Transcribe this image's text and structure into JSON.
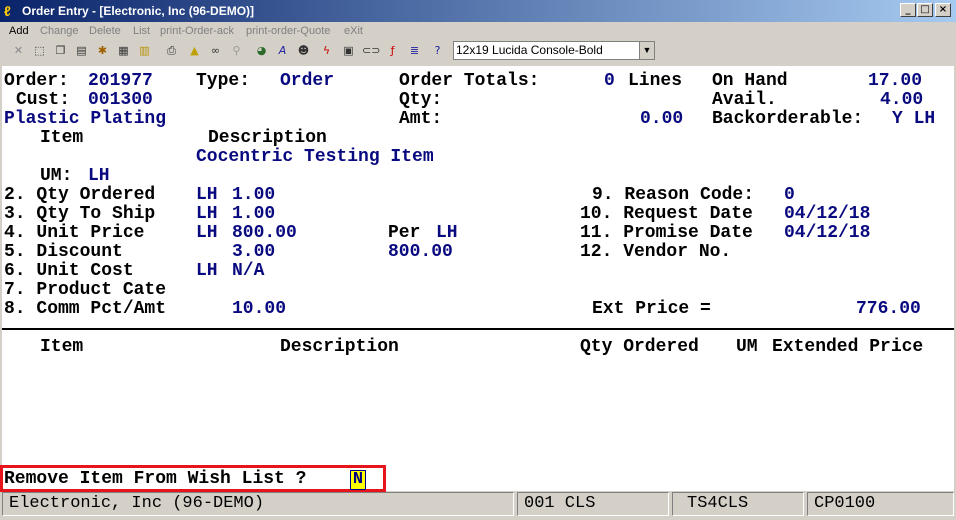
{
  "window": {
    "title": "Order Entry - [Electronic, Inc (96-DEMO)]",
    "minimize": "_",
    "maximize": "□",
    "close": "×"
  },
  "menu": {
    "add": "Add",
    "change": "Change",
    "delete": "Delete",
    "list": "List",
    "print_ack": "print-Order-ack",
    "print_quote": "print-order-Quote",
    "exit": "eXit"
  },
  "toolbar": {
    "font_select": "12x19 Lucida Console-Bold",
    "icons": [
      "close-icon",
      "select-icon",
      "copy-icon",
      "paste-icon",
      "settings-icon",
      "properties-icon",
      "notes-icon",
      "print-icon",
      "alert-icon",
      "binoculars-icon",
      "search-icon",
      "globe-icon",
      "font-icon",
      "user-icon",
      "lightning-icon",
      "calculator-icon",
      "link-icon",
      "function-icon",
      "list-icon",
      "help-icon"
    ]
  },
  "header": {
    "order_label": "Order:",
    "order_value": "201977",
    "type_label": "Type:",
    "type_value": "Order",
    "totals_label": "Order Totals:",
    "lines_value": "0",
    "lines_label": "Lines",
    "onhand_label": "On Hand",
    "onhand_value": "17.00",
    "cust_label": "Cust:",
    "cust_value": "001300",
    "qty_label": "Qty:",
    "avail_label": "Avail.",
    "avail_value": "4.00",
    "customer_name": "Plastic Plating",
    "amt_label": "Amt:",
    "amt_value": "0.00",
    "backorderable_label": "Backorderable:",
    "backorderable_value": "Y LH"
  },
  "item": {
    "item_label": "Item",
    "description_label": "Description",
    "description_value": "Cocentric Testing Item",
    "um_label": "UM:",
    "um_value": "LH"
  },
  "fields": {
    "qty_ordered_label": "2. Qty Ordered",
    "qty_ordered_um": "LH",
    "qty_ordered_value": "1.00",
    "qty_ship_label": "3. Qty To Ship",
    "qty_ship_um": "LH",
    "qty_ship_value": "1.00",
    "unit_price_label": "4. Unit Price",
    "unit_price_um": "LH",
    "unit_price_value": "800.00",
    "per_label": "Per",
    "per_um": "LH",
    "discount_label": "5. Discount",
    "discount_value": "3.00",
    "discount_price": "800.00",
    "unit_cost_label": "6. Unit Cost",
    "unit_cost_um": "LH",
    "unit_cost_value": "N/A",
    "product_cate_label": "7. Product Cate",
    "comm_label": "8. Comm Pct/Amt",
    "comm_value": "10.00",
    "reason_label": "9. Reason Code:",
    "reason_value": "0",
    "request_label": "10. Request Date",
    "request_value": "04/12/18",
    "promise_label": "11. Promise Date",
    "promise_value": "04/12/18",
    "vendor_label": "12. Vendor No.",
    "ext_price_label": "Ext Price =",
    "ext_price_value": "776.00"
  },
  "lines_table": {
    "columns": [
      "Item",
      "Description",
      "Qty Ordered",
      "UM",
      "Extended Price"
    ],
    "rows": []
  },
  "prompt": {
    "question": "Remove Item From Wish List ?",
    "answer": "N"
  },
  "statusbar": {
    "company": "Electronic, Inc (96-DEMO)",
    "cls": "001 CLS",
    "terminal": "TS4CLS",
    "port": "CP0100"
  }
}
